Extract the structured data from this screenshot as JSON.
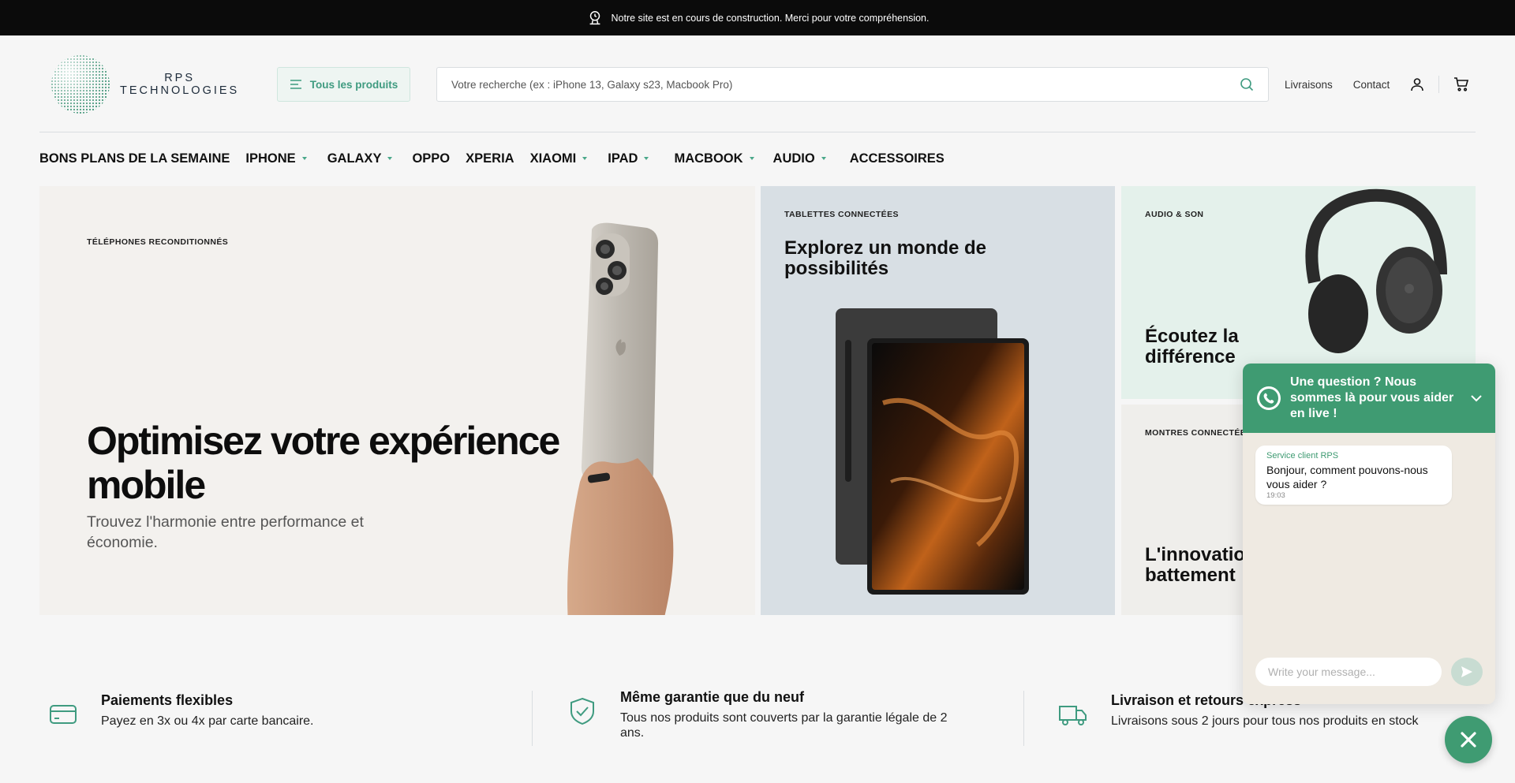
{
  "announcement": {
    "text": "Notre site est en cours de construction. Merci pour votre compréhension."
  },
  "header": {
    "logo_line1": "RPS",
    "logo_line2": "TECHNOLOGIES",
    "all_products_label": "Tous les produits",
    "search_placeholder": "Votre recherche (ex : iPhone 13, Galaxy s23, Macbook Pro)",
    "links": {
      "shipping": "Livraisons",
      "contact": "Contact"
    },
    "icons": {
      "account": "user-icon",
      "cart": "cart-icon",
      "search": "search-icon",
      "menu": "menu-icon"
    }
  },
  "nav": {
    "items": [
      {
        "label": "BONS PLANS DE LA SEMAINE"
      },
      {
        "label": "IPHONE"
      },
      {
        "label": "GALAXY"
      },
      {
        "label": "OPPO"
      },
      {
        "label": "XPERIA"
      },
      {
        "label": "XIAOMI"
      },
      {
        "label": "IPAD"
      },
      {
        "label": "MACBOOK"
      },
      {
        "label": "AUDIO"
      },
      {
        "label": "ACCESSOIRES"
      }
    ]
  },
  "hero": {
    "eyebrow": "TÉLÉPHONES RECONDITIONNÉS",
    "title": "Optimisez votre expérience mobile",
    "subtitle": "Trouvez l'harmonie entre performance et économie."
  },
  "tablets": {
    "eyebrow": "TABLETTES CONNECTÉES",
    "title": "Explorez un monde de possibilités"
  },
  "audio": {
    "eyebrow": "AUDIO & SON",
    "title": "Écoutez la différence"
  },
  "watches": {
    "eyebrow": "MONTRES CONNECTÉES",
    "title": "L'innovation à chaque battement"
  },
  "features": [
    {
      "title": "Paiements flexibles",
      "text": "Payez en 3x ou 4x par carte bancaire."
    },
    {
      "title": "Même garantie que du neuf",
      "text": "Tous nos produits sont couverts par la garantie légale de 2 ans."
    },
    {
      "title": "Livraison et retours express",
      "text": "Livraisons sous 2 jours pour tous nos produits en stock"
    }
  ],
  "chat": {
    "header": "Une question ? Nous sommes là pour vous aider en live !",
    "sender": "Service client RPS",
    "message": "Bonjour, comment pouvons-nous vous aider ?",
    "time": "19:03",
    "input_placeholder": "Write your message..."
  },
  "colors": {
    "accent": "#3f9b72",
    "topbar": "#0b0b0b",
    "background": "#f6f6f6"
  }
}
